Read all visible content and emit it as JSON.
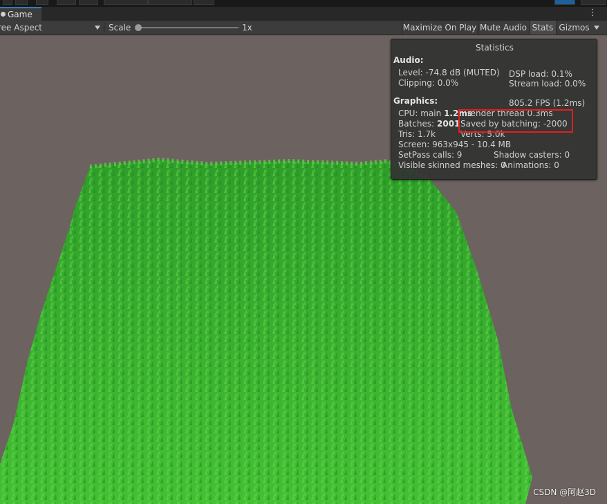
{
  "tab": {
    "label": "Game"
  },
  "toolbar": {
    "aspect_label": "ree Aspect",
    "scale_label": "Scale",
    "scale_value": "1x",
    "maximize_label": "Maximize On Play",
    "mute_label": "Mute Audio",
    "stats_label": "Stats",
    "gizmos_label": "Gizmos"
  },
  "stats": {
    "title": "Statistics",
    "audio_header": "Audio:",
    "level": "Level: -74.8 dB (MUTED)",
    "clipping": "Clipping: 0.0%",
    "dsp_load": "DSP load: 0.1%",
    "stream_load": "Stream load: 0.0%",
    "graphics_header": "Graphics:",
    "fps": "805.2 FPS (1.2ms)",
    "cpu_prefix": "CPU: main ",
    "cpu_main": "1.2ms",
    "render_thread": "render thread 0.3ms",
    "batches_prefix": "Batches: ",
    "batches_value": "2001",
    "saved_by_batching": "Saved by batching: -2000",
    "tris": "Tris: 1.7k",
    "verts": "Verts: 5.0k",
    "screen": "Screen: 963x945 - 10.4 MB",
    "setpass": "SetPass calls: 9",
    "shadow_casters": "Shadow casters: 0",
    "skinned_meshes": "Visible skinned meshes: 0",
    "animations": "Animations: 0"
  },
  "colors": {
    "highlight": "#e02020",
    "grass": "#3fbf2f",
    "background": "#6c625f"
  },
  "watermark": "CSDN @阿赵3D"
}
